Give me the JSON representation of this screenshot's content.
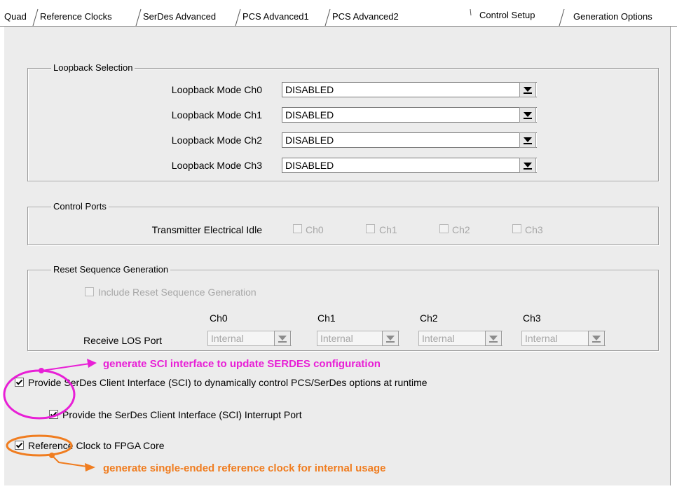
{
  "tabs": [
    {
      "label": "Quad"
    },
    {
      "label": "Reference Clocks"
    },
    {
      "label": "SerDes Advanced"
    },
    {
      "label": "PCS Advanced1"
    },
    {
      "label": "PCS Advanced2"
    },
    {
      "label": "Control Setup",
      "active": true
    },
    {
      "label": "Generation Options"
    }
  ],
  "loopback": {
    "title": "Loopback Selection",
    "rows": [
      {
        "label": "Loopback Mode Ch0",
        "value": "DISABLED"
      },
      {
        "label": "Loopback Mode Ch1",
        "value": "DISABLED"
      },
      {
        "label": "Loopback Mode Ch2",
        "value": "DISABLED"
      },
      {
        "label": "Loopback Mode Ch3",
        "value": "DISABLED"
      }
    ]
  },
  "control_ports": {
    "title": "Control Ports",
    "label": "Transmitter Electrical Idle",
    "channels": [
      {
        "label": "Ch0",
        "checked": false
      },
      {
        "label": "Ch1",
        "checked": false
      },
      {
        "label": "Ch2",
        "checked": false
      },
      {
        "label": "Ch3",
        "checked": false
      }
    ]
  },
  "reset_sequence": {
    "title": "Reset Sequence Generation",
    "include_label": "Include Reset Sequence Generation",
    "include_checked": false,
    "row_label": "Receive LOS Port",
    "channels": [
      {
        "header": "Ch0",
        "value": "Internal"
      },
      {
        "header": "Ch1",
        "value": "Internal"
      },
      {
        "header": "Ch2",
        "value": "Internal"
      },
      {
        "header": "Ch3",
        "value": "Internal"
      }
    ]
  },
  "options": {
    "sci": {
      "label": "Provide SerDes Client Interface (SCI) to dynamically control PCS/SerDes options at runtime",
      "checked": true
    },
    "sci_interrupt": {
      "label": "Provide the SerDes Client Interface (SCI) Interrupt Port",
      "checked": true
    },
    "refclk": {
      "label": "Reference Clock to FPGA Core",
      "checked": true
    }
  },
  "annotations": {
    "sci_note": "generate SCI interface to update SERDES configuration",
    "refclk_note": "generate single-ended reference clock for internal usage"
  },
  "colors": {
    "magenta": "#e81fd6",
    "orange": "#f07d20",
    "panel_bg": "#ececec"
  },
  "icons": {
    "combo_button": "down-arrow-icon",
    "checkbox_mark": "check-mark-icon"
  }
}
